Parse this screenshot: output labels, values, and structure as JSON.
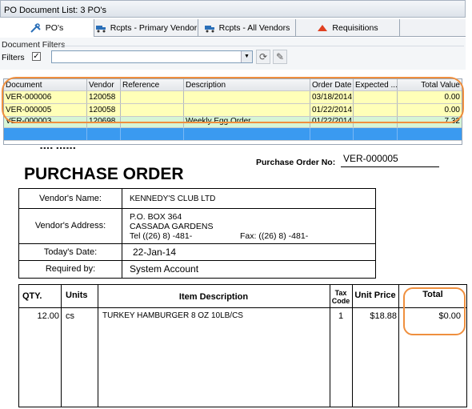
{
  "window": {
    "title": "PO Document List: 3 PO's"
  },
  "tabs": [
    {
      "label": "PO's",
      "icon": "tools-icon"
    },
    {
      "label": "Rcpts - Primary Vendor",
      "icon": "truck-icon"
    },
    {
      "label": "Rcpts - All Vendors",
      "icon": "truck-icon"
    },
    {
      "label": "Requisitions",
      "icon": "requisition-icon"
    }
  ],
  "filters": {
    "caption": "Document Filters",
    "label": "Filters",
    "checked_mark": "✓",
    "select_value": "",
    "select_arrow": "▼",
    "refresh_glyph": "⟳",
    "clear_glyph": "✎"
  },
  "grid": {
    "columns": [
      "Document",
      "Vendor",
      "Reference",
      "Description",
      "Order Date",
      "Expected ...",
      "Total Value"
    ],
    "rows": [
      {
        "document": "VER-000006",
        "vendor": "120058",
        "reference": "",
        "description": "",
        "order_date": "03/18/2014",
        "expected": "",
        "total": "0.00"
      },
      {
        "document": "VER-000005",
        "vendor": "120058",
        "reference": "",
        "description": "",
        "order_date": "01/22/2014",
        "expected": "",
        "total": "0.00"
      },
      {
        "document": "VER-000003",
        "vendor": "120698",
        "reference": "",
        "description": "Weekly Egg Order",
        "order_date": "01/22/2014",
        "expected": "",
        "total": "7.32"
      }
    ]
  },
  "po": {
    "title": "PURCHASE ORDER",
    "number_label": "Purchase Order No:",
    "number": "VER-000005",
    "vendor_name_label": "Vendor's Name:",
    "vendor_name": "KENNEDY'S CLUB LTD",
    "vendor_address_label": "Vendor's Address:",
    "address_line1": "P.O. BOX 364",
    "address_line2": "CASSADA GARDENS",
    "tel": "Tel  ((26) 8) -481-",
    "fax": "Fax: ((26) 8) -481-",
    "todays_date_label": "Today's Date:",
    "todays_date": "22-Jan-14",
    "required_by_label": "Required by:",
    "required_by": "System Account",
    "items_header": {
      "qty": "QTY.",
      "units": "Units",
      "description": "Item Description",
      "tax_code": "Tax Code",
      "unit_price": "Unit Price",
      "total": "Total"
    },
    "items": [
      {
        "qty": "12.00",
        "units": "cs",
        "description": "TURKEY HAMBURGER 8 OZ 10LB/CS",
        "tax_code": "1",
        "unit_price": "$18.88",
        "total": "$0.00"
      }
    ]
  },
  "colors": {
    "highlight": "#ef8f3e",
    "yellow_row": "#ffffb8",
    "green_row": "#d6f5d6",
    "selected_row": "#3a9af0"
  }
}
